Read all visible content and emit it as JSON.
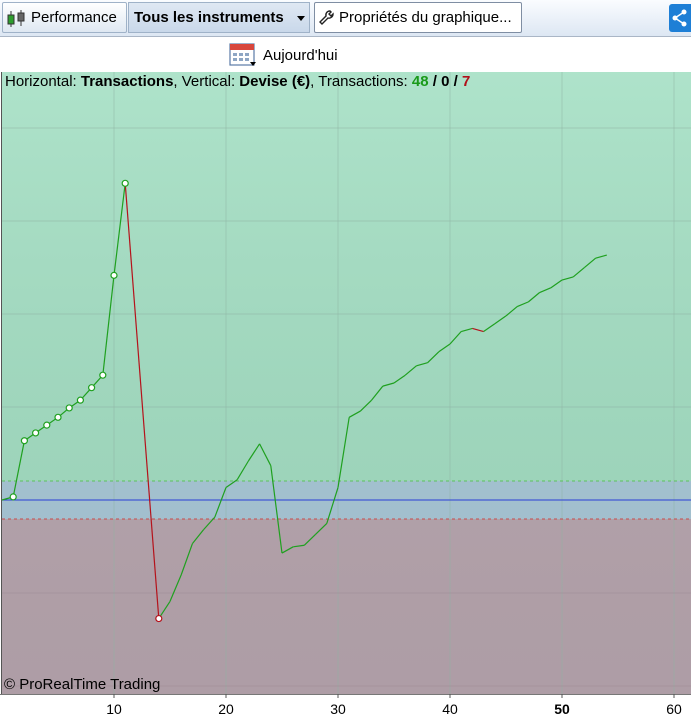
{
  "toolbar": {
    "performance_label": "Performance",
    "instruments_label": "Tous les instruments",
    "properties_label": "Propriétés du graphique...",
    "today_label": "Aujourd'hui"
  },
  "info": {
    "horizontal_prefix": "Horizontal: ",
    "horizontal_value": "Transactions",
    "vertical_prefix": ", Vertical: ",
    "vertical_value": "Devise (€)",
    "transactions_prefix": ", Transactions: ",
    "wins": "48",
    "sep1": " / ",
    "neutral": "0",
    "sep2": " / ",
    "losses": "7"
  },
  "copyright": "© ProRealTime Trading",
  "colors": {
    "win_line": "#1fa01f",
    "loss_line": "#b5121b",
    "zero_line": "#2a3fd6",
    "profit_area": "#a3dfc3",
    "loss_area": "#b9a7b0"
  },
  "chart_data": {
    "type": "line",
    "xlabel": "Transactions",
    "ylabel": "Devise (€)",
    "x_ticks": [
      "10",
      "20",
      "30",
      "40",
      "50",
      "60"
    ],
    "x_highlight": "50",
    "xlim": [
      0,
      61
    ],
    "zero": 0,
    "ylim": [
      -100,
      225
    ],
    "points": [
      [
        0,
        0
      ],
      [
        1,
        2
      ],
      [
        2,
        38
      ],
      [
        3,
        43
      ],
      [
        4,
        48
      ],
      [
        5,
        53
      ],
      [
        6,
        59
      ],
      [
        7,
        64
      ],
      [
        8,
        72
      ],
      [
        9,
        80
      ],
      [
        10,
        144
      ],
      [
        11,
        203
      ],
      [
        14,
        -76
      ],
      [
        15,
        -65
      ],
      [
        16,
        -48
      ],
      [
        17,
        -28
      ],
      [
        18,
        -19
      ],
      [
        19,
        -11
      ],
      [
        20,
        8
      ],
      [
        21,
        13
      ],
      [
        22,
        25
      ],
      [
        23,
        36
      ],
      [
        24,
        22
      ],
      [
        25,
        -34
      ],
      [
        26,
        -30
      ],
      [
        27,
        -29
      ],
      [
        28,
        -22
      ],
      [
        29,
        -15
      ],
      [
        30,
        8
      ],
      [
        31,
        53
      ],
      [
        32,
        57
      ],
      [
        33,
        64
      ],
      [
        34,
        73
      ],
      [
        35,
        75
      ],
      [
        36,
        80
      ],
      [
        37,
        86
      ],
      [
        38,
        88
      ],
      [
        39,
        95
      ],
      [
        40,
        100
      ],
      [
        41,
        108
      ],
      [
        42,
        110
      ],
      [
        43,
        108
      ],
      [
        44,
        113
      ],
      [
        45,
        118
      ],
      [
        46,
        124
      ],
      [
        47,
        127
      ],
      [
        48,
        133
      ],
      [
        49,
        136
      ],
      [
        50,
        141
      ],
      [
        51,
        143
      ],
      [
        52,
        149
      ],
      [
        53,
        155
      ],
      [
        54,
        157
      ]
    ],
    "loss_segments": [
      [
        11,
        14
      ],
      [
        23,
        25
      ],
      [
        42,
        43
      ]
    ],
    "marked_points": [
      1,
      2,
      3,
      4,
      5,
      6,
      7,
      8,
      9,
      10,
      11,
      14
    ]
  }
}
